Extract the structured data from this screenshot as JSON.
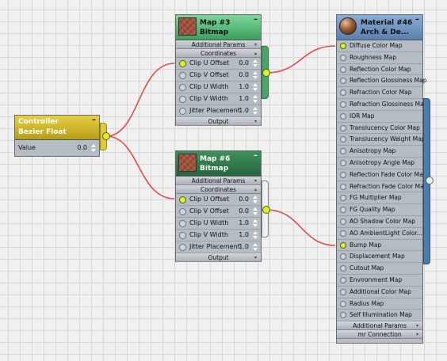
{
  "colors": {
    "wire": "#e24b4b",
    "port_connected": "#dcf02a",
    "controller_header": "#cdb21f",
    "map3_header": "#53b878",
    "map6_header": "#2f7a4a",
    "material_header": "#6b8fbd",
    "material_rail": "#4d7cab"
  },
  "controller": {
    "title1": "Controller",
    "title2": "Bezier Float",
    "rows": [
      {
        "label": "Value",
        "value": "0.0"
      }
    ]
  },
  "map3": {
    "title1": "Map #3",
    "title2": "Bitmap",
    "icon": "bitmap-thumbnail-icon",
    "additional_params": "Additional Params",
    "coordinates": "Coordinates",
    "rows": [
      {
        "label": "Clip U Offset",
        "value": "0.0",
        "connected": true
      },
      {
        "label": "Clip V Offset",
        "value": "0.0",
        "connected": false
      },
      {
        "label": "Clip U Width",
        "value": "1.0",
        "connected": false
      },
      {
        "label": "Clip V Width",
        "value": "1.0",
        "connected": false
      },
      {
        "label": "Jitter Placement",
        "value": "1.0",
        "connected": false
      }
    ],
    "output": "Output"
  },
  "map6": {
    "title1": "Map #6",
    "title2": "Bitmap",
    "icon": "bitmap-thumbnail-icon",
    "additional_params": "Additional Params",
    "coordinates": "Coordinates",
    "rows": [
      {
        "label": "Clip U Offset",
        "value": "0.0",
        "connected": true
      },
      {
        "label": "Clip V Offset",
        "value": "0.0",
        "connected": false
      },
      {
        "label": "Clip U Width",
        "value": "1.0",
        "connected": false
      },
      {
        "label": "Clip V Width",
        "value": "1.0",
        "connected": false
      },
      {
        "label": "Jitter Placement",
        "value": "1.0",
        "connected": false
      }
    ],
    "output": "Output"
  },
  "material": {
    "title1": "Material #46",
    "title2": "Arch & De...",
    "icon": "material-sphere-icon",
    "slots": [
      {
        "label": "Diffuse Color Map",
        "connected": true
      },
      {
        "label": "Roughness Map",
        "connected": false
      },
      {
        "label": "Reflection Color Map",
        "connected": false
      },
      {
        "label": "Reflection Glossiness Map",
        "connected": false
      },
      {
        "label": "Refraction Color Map",
        "connected": false
      },
      {
        "label": "Refraction Glossiness Map",
        "connected": false
      },
      {
        "label": "IOR Map",
        "connected": false
      },
      {
        "label": "Translucency Color Map",
        "connected": false
      },
      {
        "label": "Translucency Weight Map",
        "connected": false
      },
      {
        "label": "Anisotropy Map",
        "connected": false
      },
      {
        "label": "Anisotropy Angle Map",
        "connected": false
      },
      {
        "label": "Reflection Fade Color Map",
        "connected": false
      },
      {
        "label": "Refraction Fade Color Map",
        "connected": false
      },
      {
        "label": "FG Multiplier Map",
        "connected": false
      },
      {
        "label": "FG Quality Map",
        "connected": false
      },
      {
        "label": "AO Shadow Color Map",
        "connected": false
      },
      {
        "label": "AO AmbientLight Color...",
        "connected": false
      },
      {
        "label": "Bump Map",
        "connected": true
      },
      {
        "label": "Displacement Map",
        "connected": false
      },
      {
        "label": "Cutout Map",
        "connected": false
      },
      {
        "label": "Environment Map",
        "connected": false
      },
      {
        "label": "Additional Color Map",
        "connected": false
      },
      {
        "label": "Radius Map",
        "connected": false
      },
      {
        "label": "Self Illumination Map",
        "connected": false
      }
    ],
    "additional_params": "Additional Params",
    "mr_connection": "mr Connection"
  }
}
